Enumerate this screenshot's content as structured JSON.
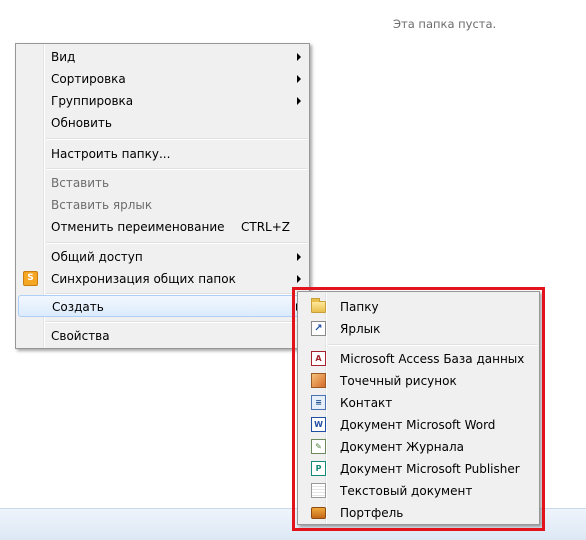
{
  "folder_view": {
    "empty_message": "Эта папка пуста."
  },
  "context_menu": {
    "items": [
      {
        "label": "Вид",
        "submenu": true
      },
      {
        "label": "Сортировка",
        "submenu": true
      },
      {
        "label": "Группировка",
        "submenu": true
      },
      {
        "label": "Обновить"
      },
      {
        "label": "Настроить папку..."
      },
      {
        "label": "Вставить",
        "disabled": true
      },
      {
        "label": "Вставить ярлык",
        "disabled": true
      },
      {
        "label": "Отменить переименование",
        "shortcut": "CTRL+Z"
      },
      {
        "label": "Общий доступ",
        "submenu": true
      },
      {
        "label": "Синхронизация общих папок",
        "submenu": true,
        "icon": "sync-icon",
        "icon_text": "S"
      },
      {
        "label": "Создать",
        "submenu": true,
        "highlighted": true
      },
      {
        "label": "Свойства"
      }
    ]
  },
  "create_submenu": {
    "items": [
      {
        "label": "Папку",
        "icon": "folder-icon"
      },
      {
        "label": "Ярлык",
        "icon": "shortcut-icon",
        "icon_text": "↗"
      },
      {
        "label": "Microsoft Access База данных",
        "icon": "access-db-icon",
        "icon_text": "A"
      },
      {
        "label": "Точечный рисунок",
        "icon": "bitmap-icon"
      },
      {
        "label": "Контакт",
        "icon": "contact-icon",
        "icon_text": "≡"
      },
      {
        "label": "Документ Microsoft Word",
        "icon": "word-doc-icon",
        "icon_text": "W"
      },
      {
        "label": "Документ Журнала",
        "icon": "journal-doc-icon",
        "icon_text": "✎"
      },
      {
        "label": "Документ Microsoft Publisher",
        "icon": "publisher-doc-icon",
        "icon_text": "P"
      },
      {
        "label": "Текстовый документ",
        "icon": "text-doc-icon"
      },
      {
        "label": "Портфель",
        "icon": "briefcase-icon"
      }
    ]
  },
  "annotation": {
    "highlight_color": "#e2131b"
  }
}
